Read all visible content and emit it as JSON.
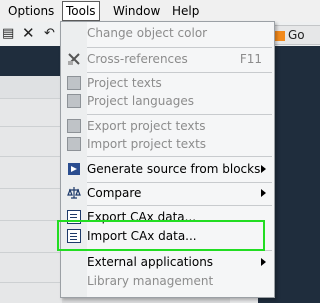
{
  "menubar": {
    "items": [
      {
        "label": "Options"
      },
      {
        "label": "Tools"
      },
      {
        "label": "Window"
      },
      {
        "label": "Help"
      }
    ]
  },
  "toolbar": {
    "online_label": "Go online",
    "online_visible": "Go online"
  },
  "tools_menu": {
    "items": [
      {
        "label": "Change object color",
        "enabled": false
      },
      {
        "label": "Cross-references",
        "shortcut": "F11",
        "enabled": false,
        "icon": "cross-references-icon"
      },
      {
        "label": "Project texts",
        "enabled": false,
        "icon": "project-texts-icon"
      },
      {
        "label": "Project languages",
        "enabled": false,
        "icon": "project-languages-icon"
      },
      {
        "label": "Export project texts",
        "enabled": false,
        "icon": "export-project-texts-icon"
      },
      {
        "label": "Import project texts",
        "enabled": false,
        "icon": "import-project-texts-icon"
      },
      {
        "label": "Generate source from blocks",
        "enabled": true,
        "submenu": true,
        "icon": "generate-source-icon"
      },
      {
        "label": "Compare",
        "enabled": true,
        "submenu": true,
        "icon": "compare-scale-icon"
      },
      {
        "label": "Export CAx data...",
        "enabled": true,
        "icon": "export-cax-icon"
      },
      {
        "label": "Import CAx data...",
        "enabled": true,
        "icon": "import-cax-icon"
      },
      {
        "label": "External applications",
        "enabled": true,
        "submenu": true
      },
      {
        "label": "Library management",
        "enabled": false
      }
    ]
  },
  "colors": {
    "highlight_border": "#22dd22",
    "dark_panel": "#1f2d3d"
  }
}
